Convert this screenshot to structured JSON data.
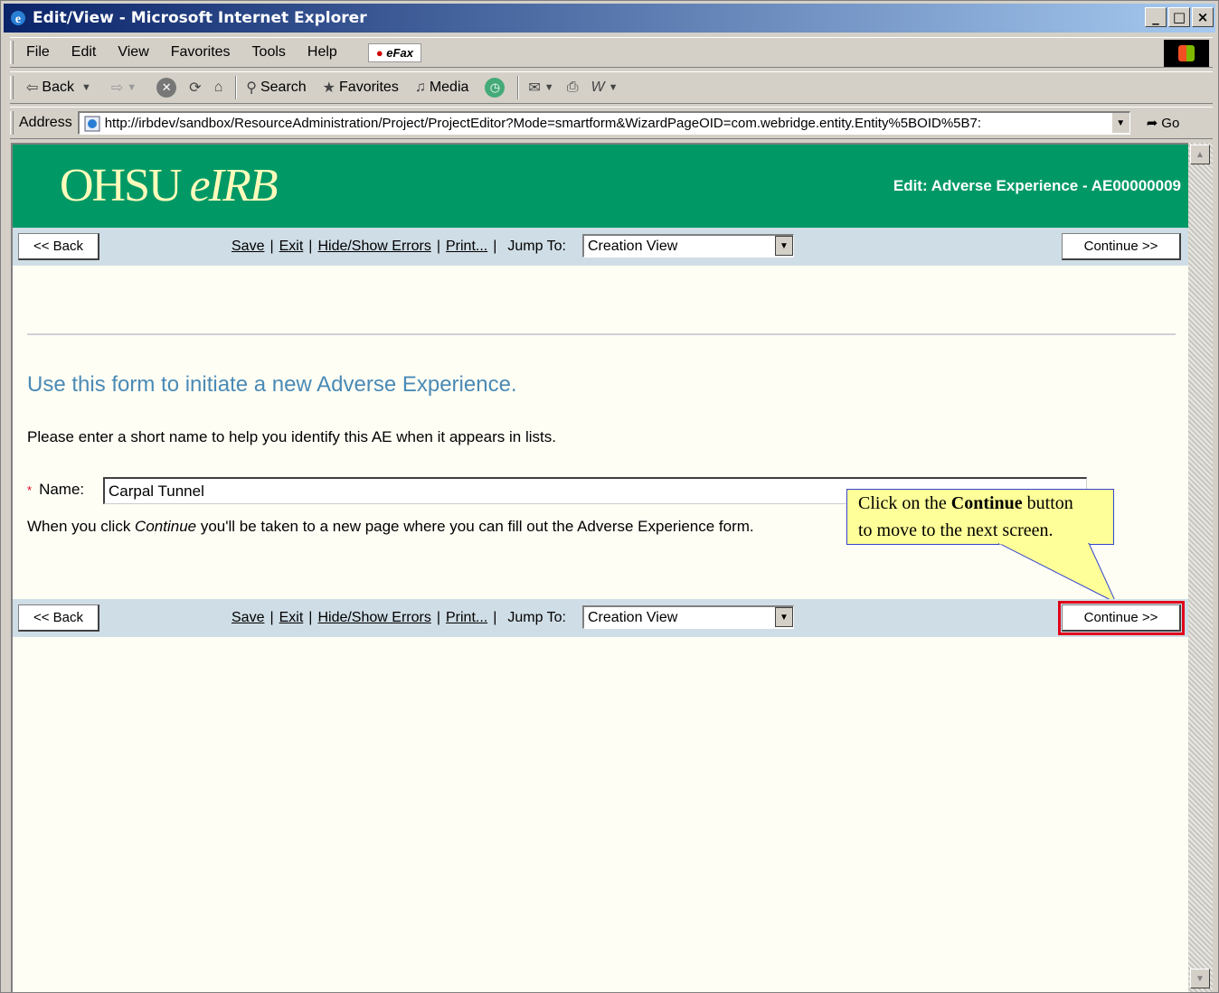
{
  "window": {
    "title": "Edit/View - Microsoft Internet Explorer",
    "minimize": "_",
    "maximize": "□",
    "close": "×"
  },
  "menu": {
    "items": [
      "File",
      "Edit",
      "View",
      "Favorites",
      "Tools",
      "Help"
    ],
    "efax": "eFax"
  },
  "toolbar": {
    "back": "Back",
    "search": "Search",
    "favorites": "Favorites",
    "media": "Media"
  },
  "address": {
    "label": "Address",
    "url": "http://irbdev/sandbox/ResourceAdministration/Project/ProjectEditor?Mode=smartform&WizardPageOID=com.webridge.entity.Entity%5BOID%5B7:",
    "go": "Go"
  },
  "header": {
    "logo_main": "OHSU",
    "logo_italic": "eIRB",
    "title": "Edit: Adverse Experience - AE00000009"
  },
  "nav": {
    "back_label": "<< Back",
    "continue_label": "Continue >>",
    "save": "Save",
    "exit": "Exit",
    "hide_show_errors": "Hide/Show Errors",
    "print": "Print...",
    "jump_to_label": "Jump To:",
    "jump_to_value": "Creation View"
  },
  "form": {
    "heading": "Use this form to initiate a new Adverse Experience.",
    "instructions": "Please enter a short name to help you identify this AE when it appears in lists.",
    "required_marker": "*",
    "name_label": "Name:",
    "name_value": "Carpal Tunnel",
    "continue_note_prefix": "When you click ",
    "continue_note_em": "Continue",
    "continue_note_suffix": " you'll be taken to a new page where you can fill out the Adverse Experience form."
  },
  "callout": {
    "line1_prefix": "Click on the ",
    "line1_bold": "Continue",
    "line1_suffix": " button",
    "line2": "to move to the next screen."
  },
  "colors": {
    "header_green": "#009966",
    "logo_yellow": "#fffbbb",
    "nav_blue": "#cfdde6",
    "heading_blue": "#4a8ab5",
    "highlight_red": "#e0001a",
    "callout_yellow": "#ffff99"
  }
}
